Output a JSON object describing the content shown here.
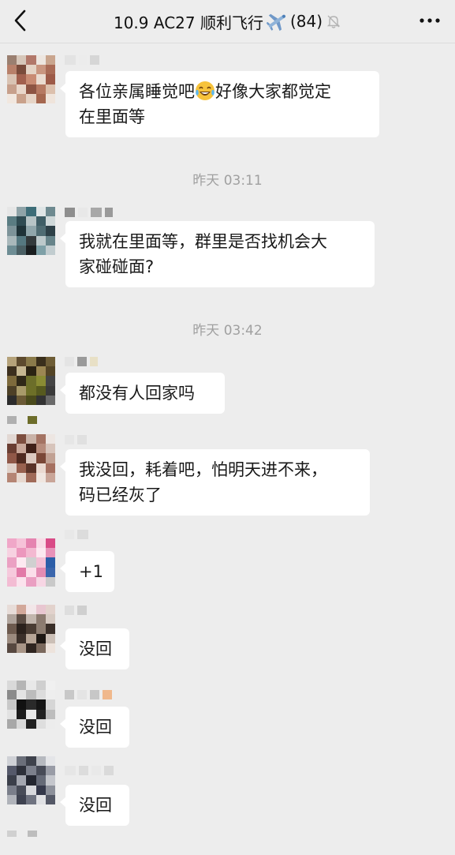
{
  "header": {
    "title": "10.9 AC27 顺利飞行",
    "count": "(84)",
    "plane_icon": "airplane-icon",
    "mute_icon": "bell-muted-icon"
  },
  "messages": [
    {
      "text_a": "各位亲属睡觉吧",
      "emoji": "laughing-tears-emoji",
      "text_b": "好像大家都觉定",
      "text_c": "在里面等"
    },
    {
      "timestamp": "昨天 03:11"
    },
    {
      "text": "我就在里面等，群里是否找机会大",
      "text2": "家碰碰面?"
    },
    {
      "timestamp": "昨天 03:42"
    },
    {
      "text": "都没有人回家吗"
    },
    {
      "text": "我没回，耗着吧，怕明天进不来，",
      "text2": "码已经灰了"
    },
    {
      "text": "+1"
    },
    {
      "text": "没回"
    },
    {
      "text": "没回"
    },
    {
      "text": "没回"
    }
  ],
  "colors": {
    "background": "#ededed",
    "bubble": "#ffffff",
    "text": "#191919",
    "timestamp": "#a0a0a0"
  }
}
